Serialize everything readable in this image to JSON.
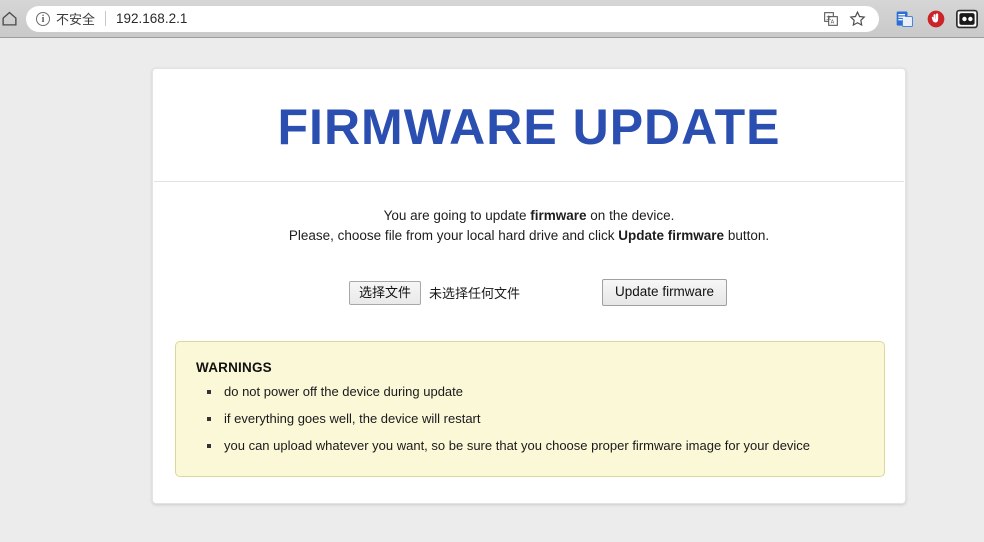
{
  "browser": {
    "home_icon": "home-icon",
    "security_chip": {
      "icon": "info-circle-icon",
      "label": "不安全"
    },
    "url": "192.168.2.1",
    "omnibox_actions": [
      {
        "name": "translate-icon"
      },
      {
        "name": "bookmark-star-icon"
      }
    ],
    "extensions": [
      {
        "name": "office-extension-icon"
      },
      {
        "name": "adblock-extension-icon"
      },
      {
        "name": "lastpass-extension-icon"
      }
    ]
  },
  "page": {
    "title": "FIRMWARE UPDATE",
    "title_color": "#2b4fb0",
    "intro": {
      "line1_pre": "You are going to update ",
      "line1_bold": "firmware",
      "line1_post": " on the device.",
      "line2_pre": "Please, choose file from your local hard drive and click ",
      "line2_bold": "Update firmware",
      "line2_post": " button."
    },
    "form": {
      "file_select_label": "选择文件",
      "file_name_label": "未选择任何文件",
      "submit_label": "Update firmware"
    },
    "warnings": {
      "title": "WARNINGS",
      "background_color": "#fbf8d8",
      "border_color": "#ddd79a",
      "items": [
        "do not power off the device during update",
        "if everything goes well, the device will restart",
        "you can upload whatever you want, so be sure that you choose proper firmware image for your device"
      ]
    }
  }
}
